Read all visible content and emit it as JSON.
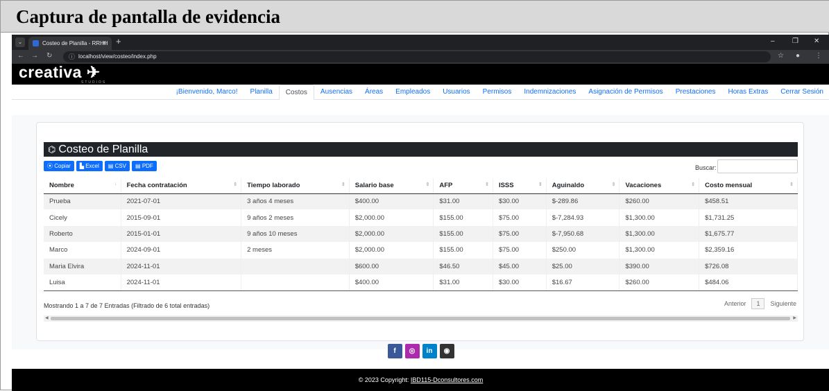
{
  "caption": "Captura de pantalla de evidencia",
  "browser": {
    "tab_title": "Costeo de Planilla - RRHH IBD1",
    "url": "localhost/view/costeo/index.php"
  },
  "site": {
    "logo": "creativa",
    "logo_sub": "STUDIOS",
    "nav": [
      {
        "label": "¡Bienvenido, Marco!",
        "active": false
      },
      {
        "label": "Planilla",
        "active": false
      },
      {
        "label": "Costos",
        "active": true
      },
      {
        "label": "Ausencias",
        "active": false
      },
      {
        "label": "Áreas",
        "active": false
      },
      {
        "label": "Empleados",
        "active": false
      },
      {
        "label": "Usuarios",
        "active": false
      },
      {
        "label": "Permisos",
        "active": false
      },
      {
        "label": "Indemnizaciones",
        "active": false
      },
      {
        "label": "Asignación de Permisos",
        "active": false
      },
      {
        "label": "Prestaciones",
        "active": false
      },
      {
        "label": "Horas Extras",
        "active": false
      },
      {
        "label": "Cerrar Sesión",
        "active": false
      }
    ]
  },
  "card": {
    "title": "Costeo de Planilla",
    "buttons": {
      "copy": "Copiar",
      "excel": "Excel",
      "csv": "CSV",
      "pdf": "PDF"
    },
    "search_label": "Buscar:",
    "search_value": ""
  },
  "table": {
    "headers": [
      "Nombre",
      "Fecha contratación",
      "Tiempo laborado",
      "Salario base",
      "AFP",
      "ISSS",
      "Aguinaldo",
      "Vacaciones",
      "Costo mensual"
    ],
    "rows": [
      [
        "Prueba",
        "2021-07-01",
        "3 años 4 meses",
        "$400.00",
        "$31.00",
        "$30.00",
        "$-289.86",
        "$260.00",
        "$458.51"
      ],
      [
        "Cicely",
        "2015-09-01",
        "9 años 2 meses",
        "$2,000.00",
        "$155.00",
        "$75.00",
        "$-7,284.93",
        "$1,300.00",
        "$1,731.25"
      ],
      [
        "Roberto",
        "2015-01-01",
        "9 años 10 meses",
        "$2,000.00",
        "$155.00",
        "$75.00",
        "$-7,950.68",
        "$1,300.00",
        "$1,675.77"
      ],
      [
        "Marco",
        "2024-09-01",
        "2 meses",
        "$2,000.00",
        "$155.00",
        "$75.00",
        "$250.00",
        "$1,300.00",
        "$2,359.16"
      ],
      [
        "Maria Elvira",
        "2024-11-01",
        "",
        "$600.00",
        "$46.50",
        "$45.00",
        "$25.00",
        "$390.00",
        "$726.08"
      ],
      [
        "Luisa",
        "2024-11-01",
        "",
        "$400.00",
        "$31.00",
        "$30.00",
        "$16.67",
        "$260.00",
        "$484.06"
      ]
    ],
    "info": "Mostrando 1 a 7 de 7 Entradas (Filtrado de 6 total entradas)",
    "pager": {
      "prev": "Anterior",
      "page": "1",
      "next": "Siguiente"
    }
  },
  "footer": {
    "text": "© 2023 Copyright: ",
    "link": "IBD115-Dconsultores.com"
  },
  "social": [
    {
      "icon": "facebook-icon",
      "glyph": "f",
      "color": "#3b5998"
    },
    {
      "icon": "instagram-icon",
      "glyph": "◎",
      "color": "#ac2bac"
    },
    {
      "icon": "linkedin-icon",
      "glyph": "in",
      "color": "#0082ca"
    },
    {
      "icon": "github-icon",
      "glyph": "◉",
      "color": "#333333"
    }
  ]
}
